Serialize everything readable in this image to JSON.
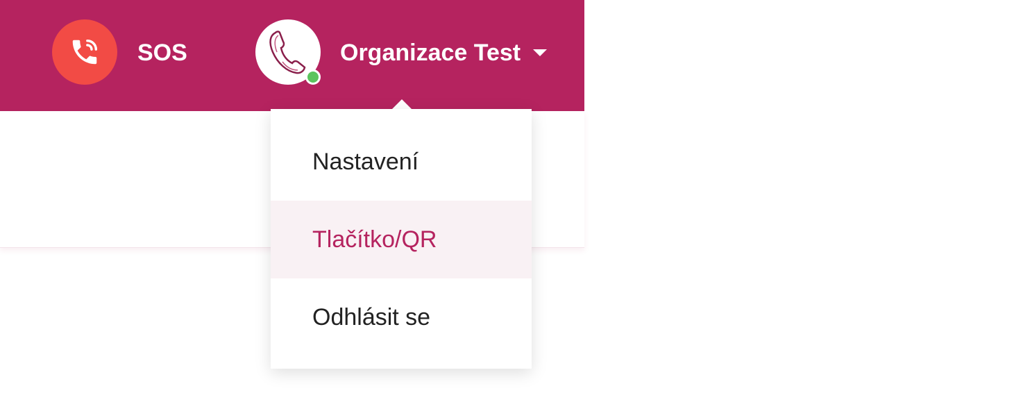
{
  "header": {
    "sos": {
      "label": "SOS",
      "icon": "phone-ringing-icon",
      "color": "#f24b45"
    },
    "organization": {
      "name": "Organizace Test",
      "avatar_icon": "telephone-handset-icon",
      "status": "online",
      "status_color": "#5cc45e"
    },
    "background_color": "#b5235f"
  },
  "user_menu": {
    "items": [
      {
        "label": "Nastavení"
      },
      {
        "label": "Tlačítko/QR",
        "highlighted": true
      },
      {
        "label": "Odhlásit se"
      }
    ]
  }
}
